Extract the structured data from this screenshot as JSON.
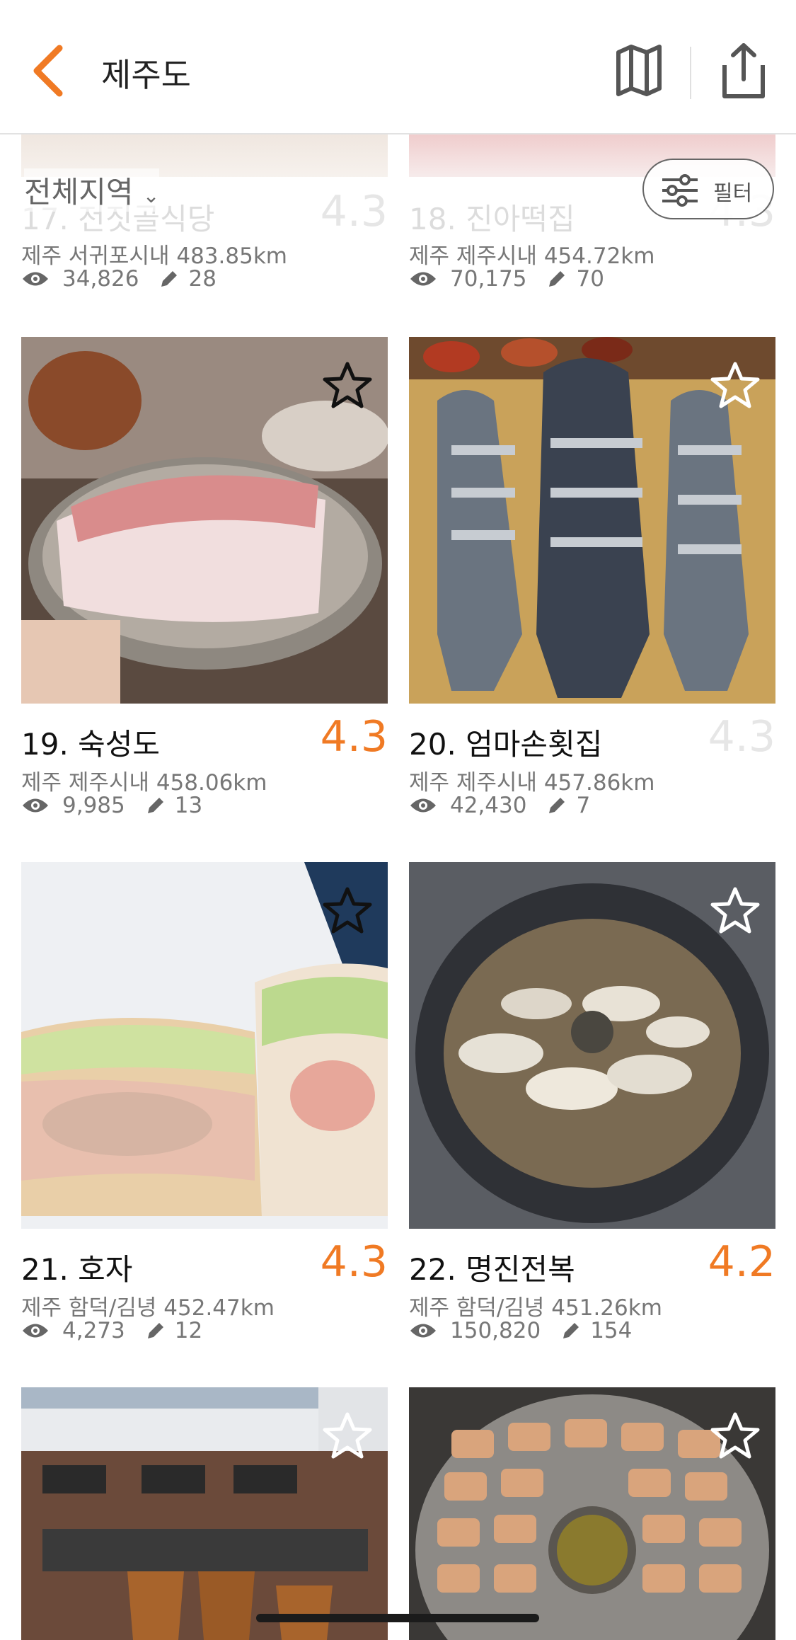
{
  "header": {
    "title": "제주도",
    "back_icon": "chevron-left-icon",
    "map_icon": "map-icon",
    "share_icon": "share-icon"
  },
  "toolbar": {
    "region_label": "전체지역",
    "filter_label": "필터"
  },
  "colors": {
    "accent": "#f07a24",
    "rating_faded": "#e6e6e6",
    "meta_text": "#777777"
  },
  "partial_cards": [
    {
      "name": "17. 전짓골식당",
      "rating": "4.3",
      "location": "제주 서귀포시내 483.85km",
      "views": "34,826",
      "reviews": "28"
    },
    {
      "name": "18. 진아떡집",
      "rating": "4.3",
      "location": "제주 제주시내 454.72km",
      "views": "70,175",
      "reviews": "70"
    }
  ],
  "cards": [
    {
      "name": "19. 숙성도",
      "rating": "4.3",
      "location": "제주 제주시내 458.06km",
      "views": "9,985",
      "reviews": "13",
      "image": "pork-chop-photo"
    },
    {
      "name": "20. 엄마손횟집",
      "rating": "4.3",
      "location": "제주 제주시내 457.86km",
      "views": "42,430",
      "reviews": "7",
      "image": "sliced-fish-photo"
    },
    {
      "name": "21. 호자",
      "rating": "4.3",
      "location": "제주 함덕/김녕 452.47km",
      "views": "4,273",
      "reviews": "12",
      "image": "sandwich-photo"
    },
    {
      "name": "22. 명진전복",
      "rating": "4.2",
      "location": "제주 함덕/김녕 451.26km",
      "views": "150,820",
      "reviews": "154",
      "image": "abalone-rice-photo"
    },
    {
      "name": "",
      "rating": "",
      "location": "",
      "views": "",
      "reviews": "",
      "image": "cafe-building-photo"
    },
    {
      "name": "",
      "rating": "",
      "location": "",
      "views": "",
      "reviews": "",
      "image": "grilled-pork-photo"
    }
  ]
}
